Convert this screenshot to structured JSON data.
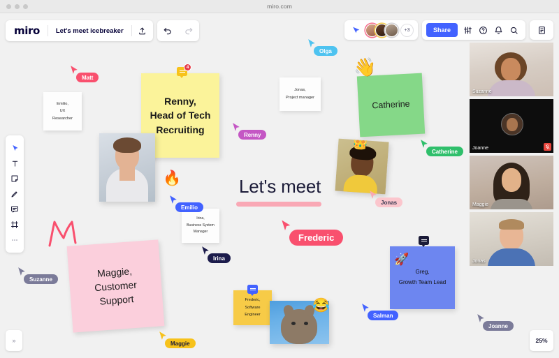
{
  "browser": {
    "url": "miro.com"
  },
  "toolbar": {
    "logo": "miro",
    "board_title": "Let's meet icebreaker",
    "upload_icon": "upload-icon",
    "undo_icon": "undo-icon",
    "redo_icon": "redo-icon"
  },
  "collaborators": {
    "presence_icon": "presence-cursor-icon",
    "overflow_label": "+3",
    "share_label": "Share",
    "settings_icon": "sliders-icon",
    "help_icon": "help-circle-icon",
    "notifications_icon": "bell-icon",
    "search_icon": "search-icon",
    "notes_icon": "notes-panel-icon"
  },
  "left_toolbar": {
    "items": [
      {
        "name": "select-cursor-icon",
        "label": "Select"
      },
      {
        "name": "text-icon",
        "label": "Text"
      },
      {
        "name": "sticky-note-icon",
        "label": "Sticky note"
      },
      {
        "name": "pen-icon",
        "label": "Pen"
      },
      {
        "name": "comment-icon",
        "label": "Comment"
      },
      {
        "name": "frame-icon",
        "label": "Frame"
      },
      {
        "name": "more-icon",
        "label": "More"
      }
    ]
  },
  "board": {
    "title": "Let's meet",
    "notes": [
      {
        "id": "renny",
        "text": "Renny,\nHead of Tech\nRecruiting",
        "color": "#fbf39a",
        "comments": "4"
      },
      {
        "id": "maggie",
        "text": "Maggie,\nCustomer\nSupport",
        "color": "#fbcfdc"
      },
      {
        "id": "catherine",
        "text": "Catherine",
        "color": "#85d888"
      },
      {
        "id": "greg",
        "text": "Greg,\nGrowth Team Lead",
        "color": "#6d86f0"
      },
      {
        "id": "frederic",
        "text": "Frederic,\nSoftware\nEngineer",
        "color": "#f7cb47"
      }
    ],
    "cards": [
      {
        "id": "emilio",
        "text": "Emilio,\nUX\nResearcher"
      },
      {
        "id": "jonas",
        "text": "Jonas,\nProject manager"
      },
      {
        "id": "irina",
        "text": "Irina,\nBusiness System\nManager"
      }
    ],
    "emojis": [
      {
        "id": "wave",
        "glyph": "👋"
      },
      {
        "id": "fire",
        "glyph": "🔥"
      },
      {
        "id": "rocket",
        "glyph": "🚀"
      },
      {
        "id": "joy",
        "glyph": "😂"
      },
      {
        "id": "crown",
        "glyph": "👑"
      }
    ],
    "cursors": [
      {
        "name": "Matt",
        "color": "#f9506e"
      },
      {
        "name": "Olga",
        "color": "#4ec3f0"
      },
      {
        "name": "Renny",
        "color": "#c457c4"
      },
      {
        "name": "Catherine",
        "color": "#2fbf6b"
      },
      {
        "name": "Emilio",
        "color": "#4262ff"
      },
      {
        "name": "Jonas",
        "color": "#fbc6cd",
        "text_color": "#3a3a52"
      },
      {
        "name": "Frederic",
        "color": "#f9506e"
      },
      {
        "name": "Irina",
        "color": "#1b1b4b"
      },
      {
        "name": "Suzanne",
        "color": "#7b7b99"
      },
      {
        "name": "Maggie",
        "color": "#f7c21b",
        "text_color": "#1b1b38"
      },
      {
        "name": "Salman",
        "color": "#4262ff"
      },
      {
        "name": "Joanne",
        "color": "#7b7b99"
      }
    ]
  },
  "video_panel": {
    "tiles": [
      {
        "name": "Suzanne",
        "muted": false,
        "camera_off": false
      },
      {
        "name": "Joanne",
        "muted": true,
        "camera_off": true
      },
      {
        "name": "Maggie",
        "muted": false,
        "camera_off": false
      },
      {
        "name": "Jonas",
        "muted": false,
        "camera_off": false
      }
    ]
  },
  "footer": {
    "collapse_label": "»",
    "zoom_level": "25%"
  }
}
